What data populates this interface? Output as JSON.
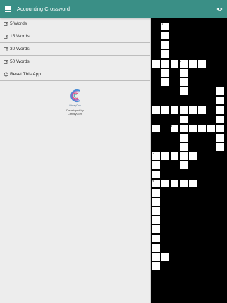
{
  "app": {
    "title": "Accounting Crossword"
  },
  "drawer": {
    "items": [
      {
        "label": "5 Words",
        "icon": "edit-icon"
      },
      {
        "label": "15 Words",
        "icon": "edit-icon"
      },
      {
        "label": "30 Words",
        "icon": "edit-icon"
      },
      {
        "label": "50 Words",
        "icon": "edit-icon"
      },
      {
        "label": "Reset This App",
        "icon": "refresh-icon"
      }
    ],
    "logo_caption": "CitrusyCom",
    "developer_line1": "Developed by",
    "developer_line2": "CitrusyCom"
  },
  "crossword": {
    "clue_numbers": [
      "1",
      "2",
      "3",
      "4",
      "5"
    ]
  },
  "colors": {
    "accent": "#3a8f86",
    "drawer_bg": "#ededed",
    "board_bg": "#000000"
  }
}
